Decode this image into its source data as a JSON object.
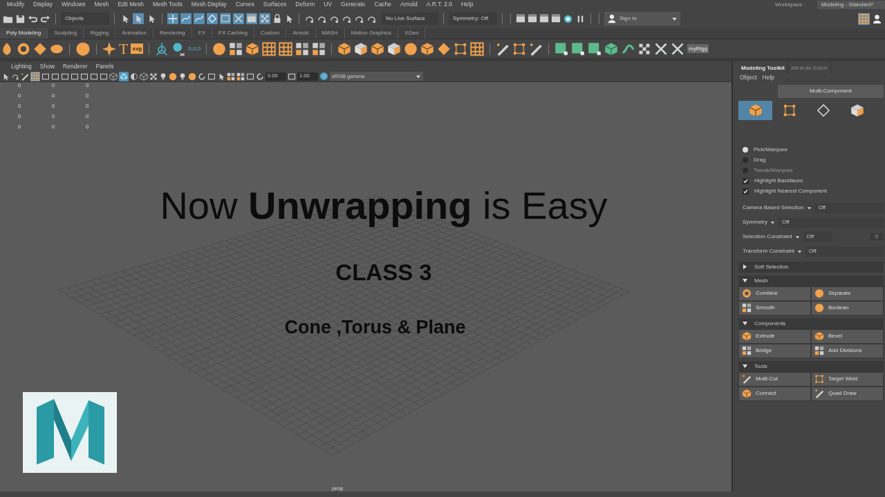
{
  "menu_bar": {
    "items": [
      "Modify",
      "Display",
      "Windows",
      "Mesh",
      "Edit Mesh",
      "Mesh Tools",
      "Mesh Display",
      "Curves",
      "Surfaces",
      "Deform",
      "UV",
      "Generate",
      "Cache",
      "Arnold",
      "A.R.T. 2.0",
      "Help"
    ]
  },
  "workspace": {
    "label": "Workspace :",
    "value": "Modeling - Standard*"
  },
  "status_line": {
    "menu_set": "Objects",
    "live_surface": "No Live Surface",
    "symmetry": "Symmetry: Off",
    "sign_in": "Sign In",
    "select_modes": [
      {
        "selected": false
      },
      {
        "selected": true
      },
      {
        "selected": false
      }
    ],
    "snap_toggles": [
      {
        "on": true
      },
      {
        "on": true
      },
      {
        "on": true
      },
      {
        "on": true
      },
      {
        "on": true
      },
      {
        "on": true
      },
      {
        "on": true
      },
      {
        "on": true
      }
    ]
  },
  "shelf_tabs": [
    {
      "label": "Poly Modeling",
      "selected": true
    },
    {
      "label": "Sculpting",
      "selected": false
    },
    {
      "label": "Rigging",
      "selected": false
    },
    {
      "label": "Animation",
      "selected": false
    },
    {
      "label": "Rendering",
      "selected": false
    },
    {
      "label": "FX",
      "selected": false
    },
    {
      "label": "FX Caching",
      "selected": false
    },
    {
      "label": "Custom",
      "selected": false
    },
    {
      "label": "Arnold",
      "selected": false
    },
    {
      "label": "MASH",
      "selected": false
    },
    {
      "label": "Motion Graphics",
      "selected": false
    },
    {
      "label": "XGen",
      "selected": false
    }
  ],
  "shelf": {
    "icon_texts": [
      "T",
      "svg",
      "0,0,0",
      "myRigg"
    ]
  },
  "viewport": {
    "menus": [
      "Lighting",
      "Show",
      "Renderer",
      "Panels"
    ],
    "display_toggles": [
      {
        "on": true
      },
      {
        "on": true
      }
    ],
    "exposure": "0.00",
    "gamma": "1.00",
    "color_space": "sRGB gamma",
    "hud_rows": [
      [
        "0",
        "0",
        "0"
      ],
      [
        "0",
        "0",
        "0"
      ],
      [
        "0",
        "0",
        "0"
      ],
      [
        "0",
        "0",
        "0"
      ],
      [
        "0",
        "0",
        "0"
      ]
    ],
    "camera": "persp"
  },
  "overlay": {
    "title": "Now **Unwrapping** is Easy",
    "subtitle": "CLASS 3",
    "caption": "Cone ,Torus & Plane"
  },
  "toolkit": {
    "tabs": [
      {
        "label": "Modeling Toolkit",
        "selected": true
      },
      {
        "label": "Attribute Editor",
        "selected": false
      }
    ],
    "menus": [
      "Object",
      "Help"
    ],
    "mode_label": "Multi-Component",
    "modes": [
      {
        "selected": true
      },
      {
        "selected": false
      },
      {
        "selected": false
      },
      {
        "selected": false
      }
    ],
    "pick_options": [
      {
        "label": "Pick/Marquee",
        "selected": true,
        "disabled": false
      },
      {
        "label": "Drag",
        "selected": false,
        "disabled": false
      },
      {
        "label": "Tweak/Marquee",
        "selected": false,
        "disabled": true
      }
    ],
    "checkboxes": [
      {
        "label": "Highlight Backfaces",
        "checked": true
      },
      {
        "label": "Highlight Nearest Component",
        "checked": true
      }
    ],
    "settings": [
      {
        "label": "Camera Based Selection",
        "value": "Off"
      },
      {
        "label": "Symmetry",
        "value": "Off"
      },
      {
        "label": "Selection Constraint",
        "value": "Off",
        "extra": "0"
      },
      {
        "label": "Transform Constraint",
        "value": "Off"
      }
    ],
    "soft_selection": {
      "label": "Soft Selection",
      "expanded": false
    },
    "sections": [
      {
        "title": "Mesh",
        "expanded": true,
        "tools": [
          "Combine",
          "Separate",
          "Smooth",
          "Boolean"
        ]
      },
      {
        "title": "Components",
        "expanded": true,
        "tools": [
          "Extrude",
          "Bevel",
          "Bridge",
          "Add Divisions"
        ]
      },
      {
        "title": "Tools",
        "expanded": true,
        "tools": [
          "Multi-Cut",
          "Target Weld",
          "Connect",
          "Quad Draw"
        ]
      }
    ]
  }
}
